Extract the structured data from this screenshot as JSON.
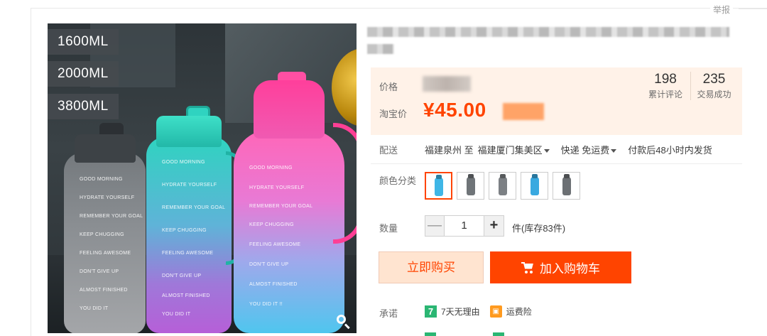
{
  "header": {
    "report_label": "举报"
  },
  "gallery": {
    "capacity_labels": [
      "1600ML",
      "2000ML",
      "3800ML"
    ],
    "bottle_markings": {
      "gray": [
        "GOOD MORNING",
        "HYDRATE YOURSELF",
        "REMEMBER YOUR GOAL",
        "KEEP CHUGGING",
        "FEELING AWESOME",
        "DON'T GIVE UP",
        "ALMOST FINISHED",
        "YOU DID IT"
      ],
      "teal": [
        "GOOD MORNING",
        "HYDRATE YOURSELF",
        "REMEMBER YOUR GOAL",
        "KEEP CHUGGING",
        "FEELING AWESOME",
        "DON'T GIVE UP",
        "ALMOST FINISHED",
        "YOU DID IT"
      ],
      "pink": [
        "GOOD MORNING",
        "HYDRATE YOURSELF",
        "REMEMBER YOUR GOAL",
        "KEEP CHUGGING",
        "FEELING AWESOME",
        "DON'T GIVE UP",
        "ALMOST FINISHED",
        "YOU DID IT !!"
      ]
    },
    "zoom_icon": "magnifier-icon"
  },
  "price_box": {
    "price_label": "价格",
    "taobao_price_label": "淘宝价",
    "taobao_price": "¥45.00",
    "reviews_count": "198",
    "reviews_label": "累计评论",
    "deals_count": "235",
    "deals_label": "交易成功"
  },
  "delivery": {
    "label": "配送",
    "from": "福建泉州 至",
    "to": "福建厦门集美区",
    "method": "快递 免运费",
    "ship_time": "付款后48小时内发货"
  },
  "color": {
    "label": "颜色分类",
    "options": [
      {
        "color": "#3fb6e6",
        "selected": true
      },
      {
        "color": "#6f7478",
        "selected": false
      },
      {
        "color": "#7c8084",
        "selected": false
      },
      {
        "color": "#39a9e0",
        "selected": false
      },
      {
        "color": "#6c7074",
        "selected": false
      }
    ]
  },
  "quantity": {
    "label": "数量",
    "minus": "—",
    "value": "1",
    "plus": "+",
    "stock": "件(库存83件)"
  },
  "actions": {
    "buy_now": "立即购买",
    "add_to_cart": "加入购物车",
    "cart_icon": "cart-icon"
  },
  "promise": {
    "label": "承诺",
    "seven_icon_text": "7",
    "seven_days": "7天无理由",
    "freight_insurance": "运费险"
  },
  "colors": {
    "accent": "#ff4400",
    "price_bg": "#fff2e8",
    "buy_bg": "#ffe4d0"
  }
}
